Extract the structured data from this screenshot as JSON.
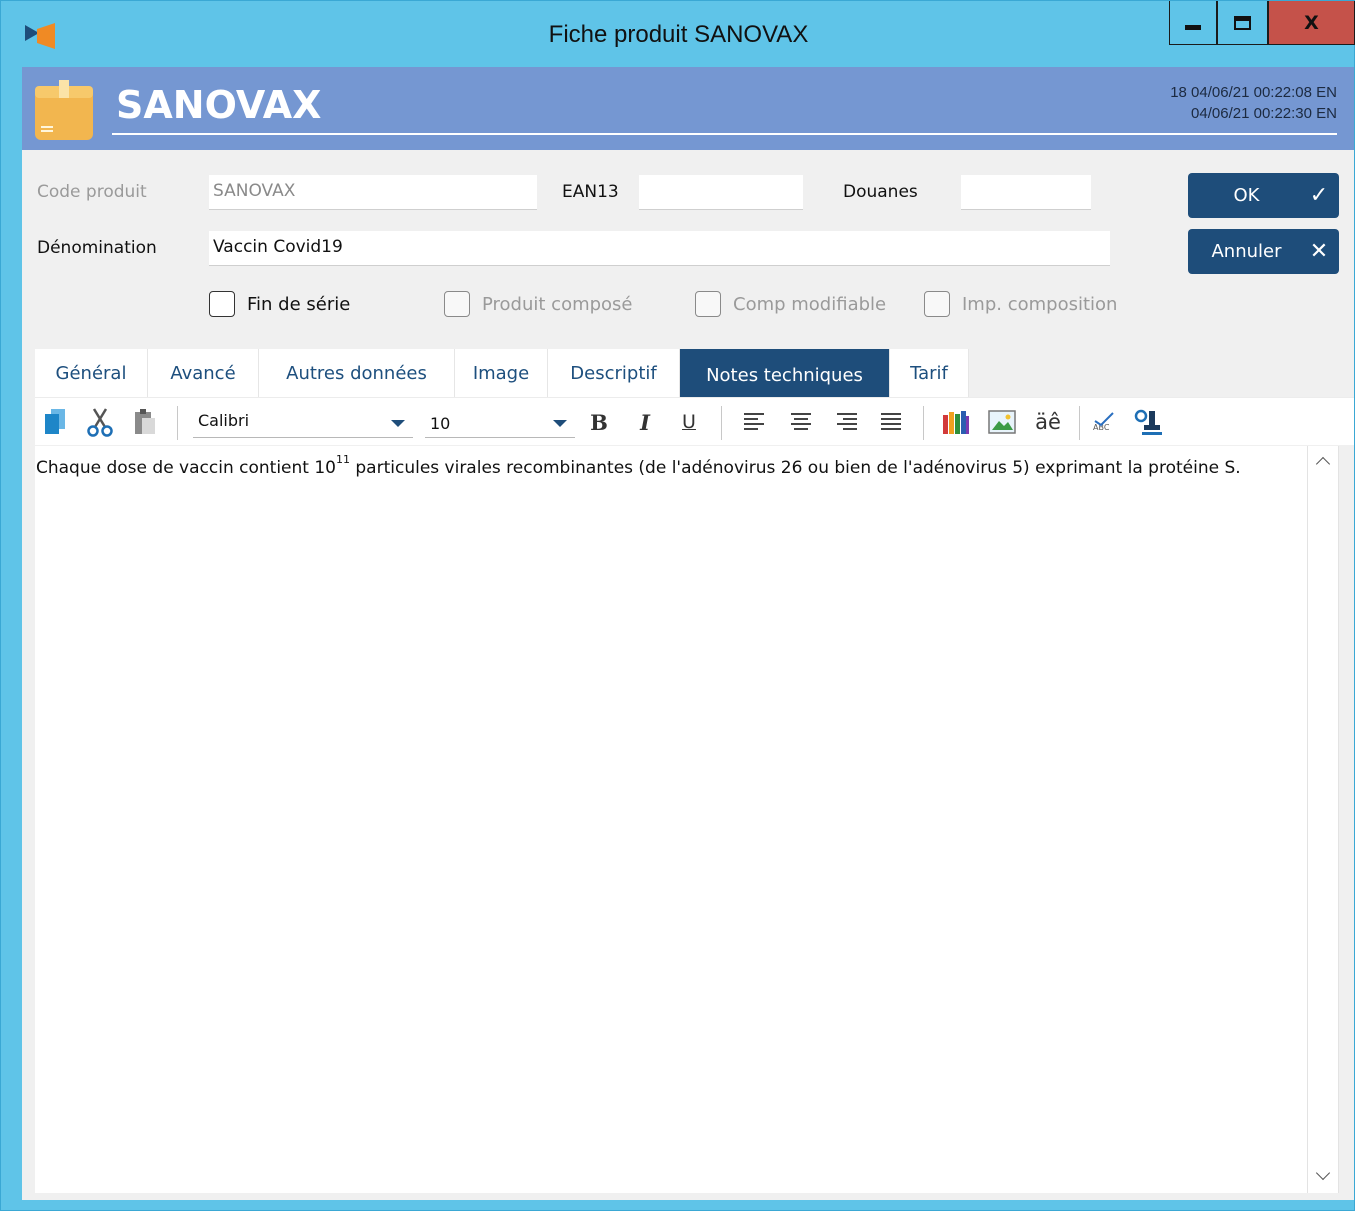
{
  "window": {
    "title": "Fiche produit SANOVAX",
    "minimize_label": "",
    "maximize_label": "",
    "close_label": "X"
  },
  "header": {
    "title": "SANOVAX",
    "meta_line1": "18  04/06/21 00:22:08  EN",
    "meta_line2": "04/06/21 00:22:30  EN"
  },
  "form": {
    "code_label": "Code produit",
    "code_value": "SANOVAX",
    "ean_label": "EAN13",
    "ean_value": "",
    "douanes_label": "Douanes",
    "douanes_value": "",
    "denomination_label": "Dénomination",
    "denomination_value": "Vaccin Covid19",
    "checkboxes": [
      {
        "label": "Fin de série",
        "checked": false,
        "enabled": true
      },
      {
        "label": "Produit composé",
        "checked": false,
        "enabled": false
      },
      {
        "label": "Comp modifiable",
        "checked": false,
        "enabled": false
      },
      {
        "label": "Imp. composition",
        "checked": false,
        "enabled": false
      }
    ]
  },
  "buttons": {
    "ok_label": "OK",
    "cancel_label": "Annuler"
  },
  "tabs": [
    {
      "label": "Général"
    },
    {
      "label": "Avancé"
    },
    {
      "label": "Autres données"
    },
    {
      "label": "Image"
    },
    {
      "label": "Descriptif"
    },
    {
      "label": "Notes techniques",
      "active": true
    },
    {
      "label": "Tarif"
    }
  ],
  "toolbar": {
    "font_name": "Calibri",
    "font_size": "10",
    "bold": "B",
    "italic": "I",
    "underline": "U",
    "accents": "äê",
    "icons": [
      "copy-icon",
      "cut-icon",
      "paste-icon",
      "align-left-icon",
      "align-center-icon",
      "align-right-icon",
      "align-justify-icon",
      "color-pencils-icon",
      "image-icon",
      "accents-icon",
      "spellcheck-icon",
      "find-replace-icon"
    ]
  },
  "editor": {
    "text_before": "Chaque dose de vaccin contient 10",
    "superscript": "11",
    "text_after": " particules virales recombinantes (de l'adénovirus 26 ou bien de l'adénovirus 5) exprimant la protéine S."
  },
  "colors": {
    "titlebar": "#5fc4e8",
    "header": "#7597d2",
    "primary_button": "#1e4d7a",
    "close_button": "#c5524a",
    "tab_text": "#1d4f7e"
  }
}
